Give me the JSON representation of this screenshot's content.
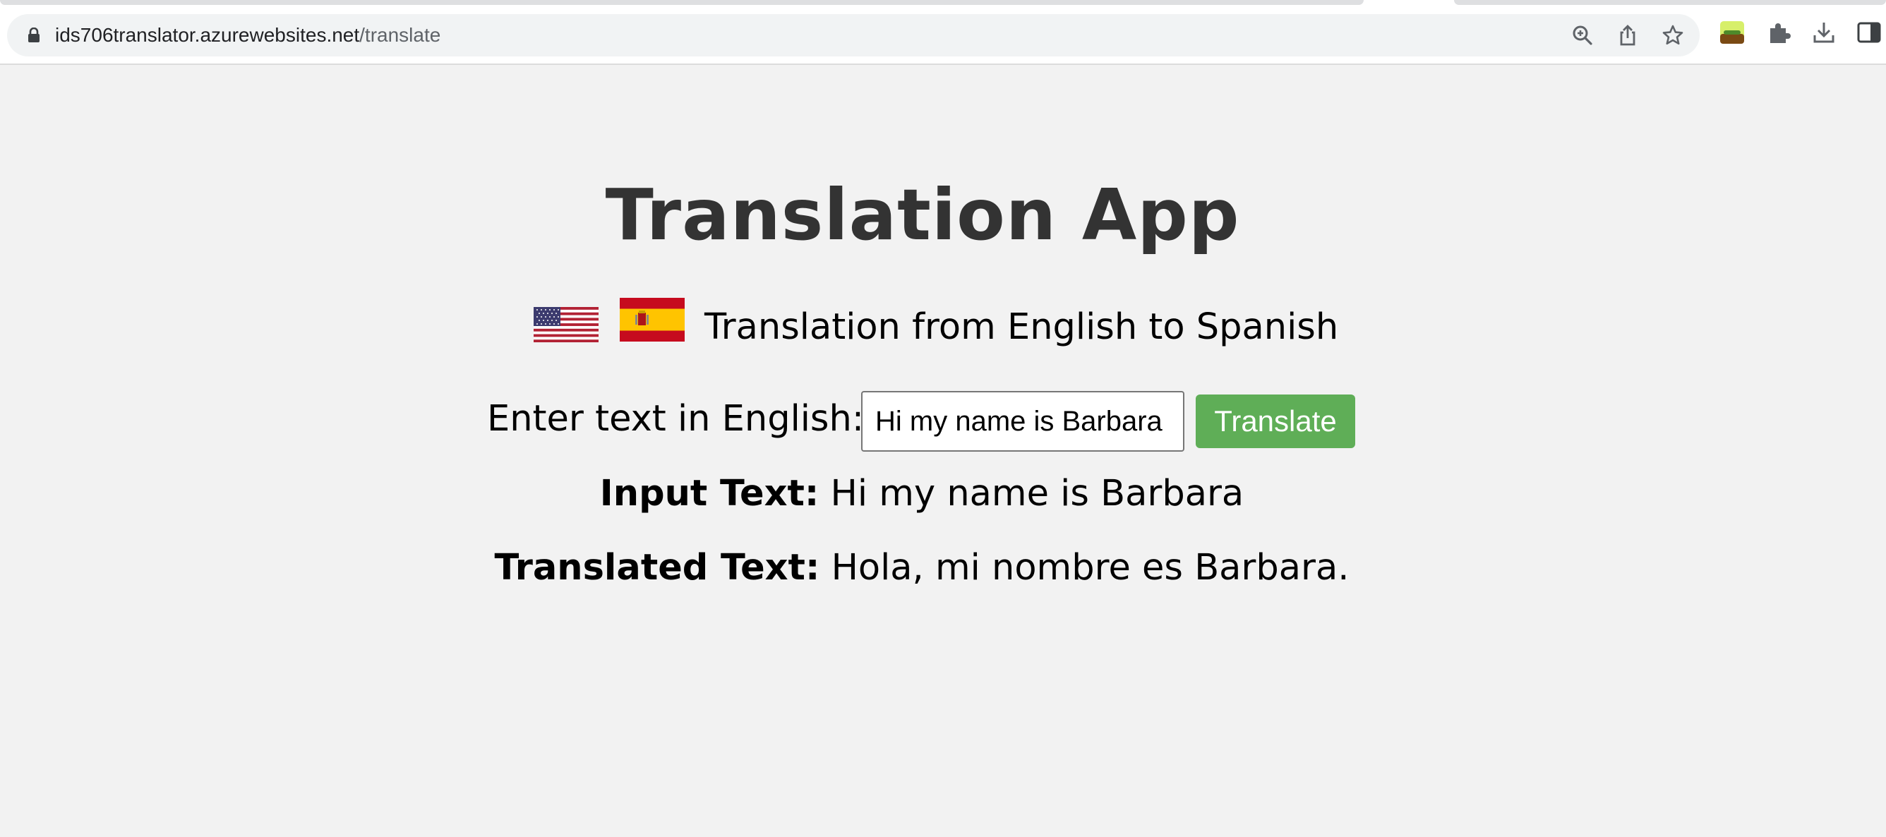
{
  "browser": {
    "url_host": "ids706translator.azurewebsites.net",
    "url_path": "/translate",
    "icons": [
      "lock-icon",
      "zoom-icon",
      "share-icon",
      "bookmark-star-icon",
      "extension-app-icon",
      "extensions-puzzle-icon",
      "download-icon",
      "side-panel-icon"
    ]
  },
  "page": {
    "title": "Translation App",
    "subtitle": "Translation from English to Spanish",
    "flags": [
      "us-flag-icon",
      "spain-flag-icon"
    ],
    "form": {
      "label": "Enter text in English:",
      "input_value": "Hi my name is Barbara",
      "button_label": "Translate"
    },
    "input_text": {
      "label": "Input Text:",
      "value": "Hi my name is Barbara"
    },
    "translated_text": {
      "label": "Translated Text:",
      "value": "Hola, mi nombre es Barbara."
    }
  },
  "colors": {
    "page_background": "#f2f2f2",
    "title": "#333333",
    "button": "#5fae57",
    "button_text": "#ffffff"
  }
}
